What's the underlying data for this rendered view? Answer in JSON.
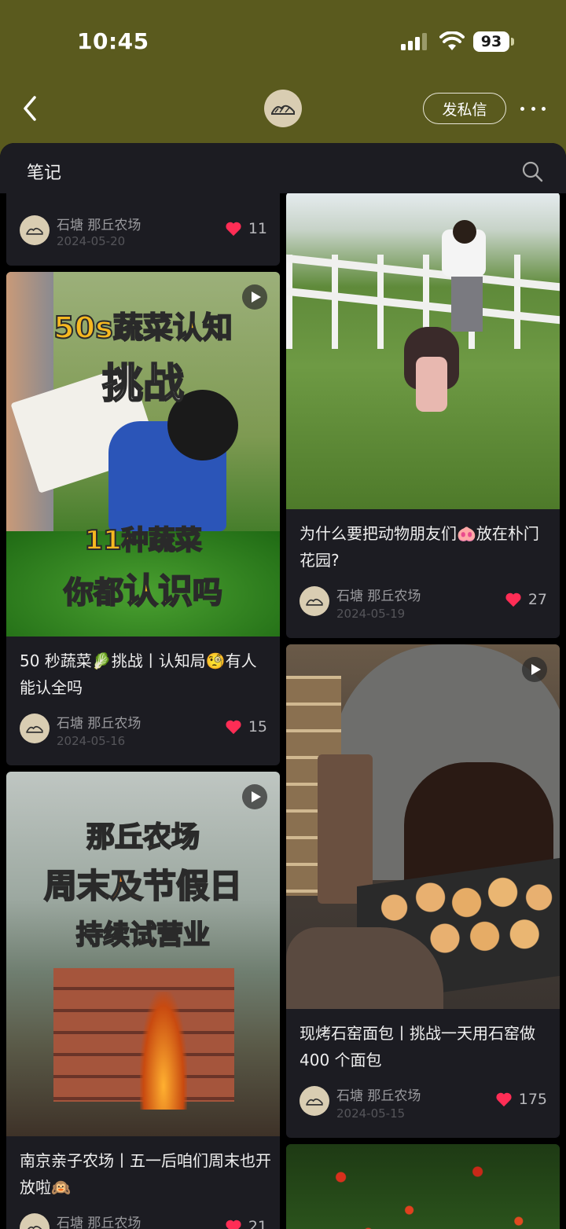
{
  "status_bar": {
    "time": "10:45",
    "battery": "93"
  },
  "header": {
    "dm_label": "发私信"
  },
  "section": {
    "title": "笔记"
  },
  "colors": {
    "header_bg": "#5a5a1e",
    "like": "#ff2d55"
  },
  "cards": [
    {
      "author": "石塘 那丘农场",
      "date": "2024-05-20",
      "likes": "11"
    },
    {
      "title": "50 秒蔬菜🥬挑战丨认知局🧐有人能认全吗",
      "author": "石塘 那丘农场",
      "date": "2024-05-16",
      "likes": "15",
      "has_video": true,
      "overlay": {
        "line1": "50s蔬菜认知",
        "line2": "挑战",
        "line3": "11种蔬菜",
        "line4a": "你都",
        "line4b": "认识",
        "line4c": "吗"
      }
    },
    {
      "title": "南京亲子农场丨五一后咱们周末也开放啦🙉",
      "author": "石塘 那丘农场",
      "likes": "21",
      "has_video": true,
      "overlay": {
        "line1": "那丘农场",
        "line2": "周末及节假日",
        "line3a": "持续",
        "line3b": "试营业"
      }
    },
    {
      "title": "为什么要把动物朋友们🐽放在朴门花园?",
      "author": "石塘 那丘农场",
      "date": "2024-05-19",
      "likes": "27"
    },
    {
      "title": "现烤石窑面包丨挑战一天用石窑做 400 个面包",
      "author": "石塘 那丘农场",
      "date": "2024-05-15",
      "likes": "175",
      "has_video": true
    }
  ]
}
